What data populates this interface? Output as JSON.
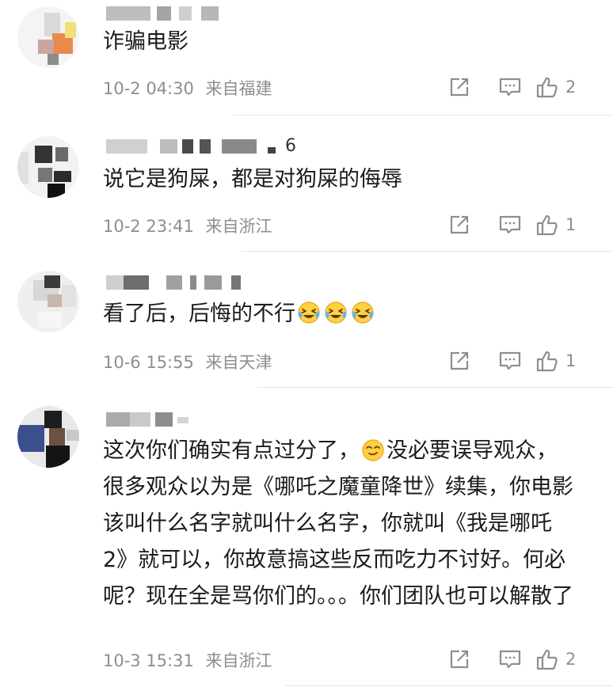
{
  "comments": [
    {
      "text": "诈骗电影",
      "time": "10-2 04:30",
      "location": "来自福建",
      "likes": "2"
    },
    {
      "username_suffix": "6",
      "text": "说它是狗屎，都是对狗屎的侮辱",
      "time": "10-2 23:41",
      "location": "来自浙江",
      "likes": "1"
    },
    {
      "text": "看了后，后悔的不行",
      "emoji_count": 3,
      "time": "10-6 15:55",
      "location": "来自天津",
      "likes": "1"
    },
    {
      "text_before": "这次你们确实有点过分了，",
      "text_after": "没必要误导观众，很多观众以为是《哪吒之魔童降世》续集，你电影该叫什么名字就叫什么名字，你就叫《我是哪吒 2》就可以，你故意搞这些反而吃力不讨好。何必呢？现在全是骂你们的。。。你们团队也可以解散了",
      "time": "10-3 15:31",
      "location": "来自浙江",
      "likes": "2"
    }
  ],
  "icons": {
    "forward": "share-forward-icon",
    "comment": "comment-bubble-icon",
    "like": "thumbs-up-icon",
    "crying_emoji": "crying-laughing-emoji",
    "smirk_emoji": "sly-smile-emoji"
  }
}
